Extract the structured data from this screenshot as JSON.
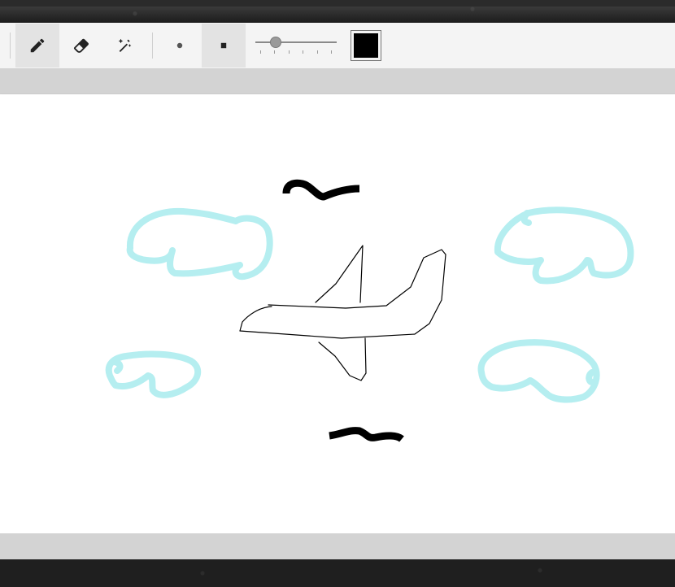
{
  "toolbar": {
    "tools": [
      {
        "name": "pencil-tool",
        "icon": "pencil-icon",
        "active": true
      },
      {
        "name": "eraser-tool",
        "icon": "eraser-icon",
        "active": false
      },
      {
        "name": "magic-eraser-tool",
        "icon": "magic-wand-icon",
        "active": false
      },
      {
        "name": "brush-round-tool",
        "icon": "round-brush-icon",
        "active": false
      },
      {
        "name": "brush-square-tool",
        "icon": "square-brush-icon",
        "active": true
      }
    ],
    "brush_size_fraction": 0.24,
    "current_color": "#000000"
  },
  "canvas": {
    "stroke_colors": {
      "clouds": "#b5eef0",
      "birds": "#000000",
      "plane": "#000000"
    }
  }
}
